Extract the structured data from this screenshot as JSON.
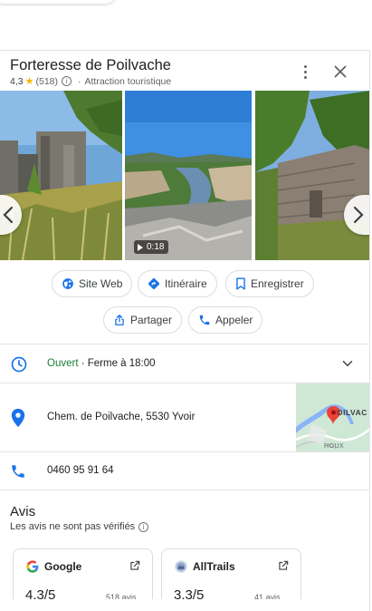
{
  "place": {
    "title": "Forteresse de Poilvache",
    "rating": "4,3",
    "review_count": "(518)",
    "category": "Attraction touristique"
  },
  "photos": {
    "video_duration": "0:18"
  },
  "actions": {
    "website": "Site Web",
    "directions": "Itinéraire",
    "save": "Enregistrer",
    "share": "Partager",
    "call": "Appeler"
  },
  "hours": {
    "status": "Ouvert",
    "closes": " · Ferme à 18:00"
  },
  "address": "Chem. de Poilvache, 5530 Yvoir",
  "map": {
    "label_top": "OILVAC",
    "label_bottom": "HOUX"
  },
  "phone": "0460 95 91 64",
  "reviews": {
    "title": "Avis",
    "disclaimer": "Les avis ne sont pas vérifiés",
    "sources": [
      {
        "name": "Google",
        "score": "4,3/5",
        "count": "518 avis"
      },
      {
        "name": "AllTrails",
        "score": "3,3/5",
        "count": "41 avis"
      }
    ]
  },
  "colors": {
    "accent": "#1a73e8",
    "open_green": "#188038",
    "star": "#f6b400",
    "pin_red": "#ea4335"
  }
}
